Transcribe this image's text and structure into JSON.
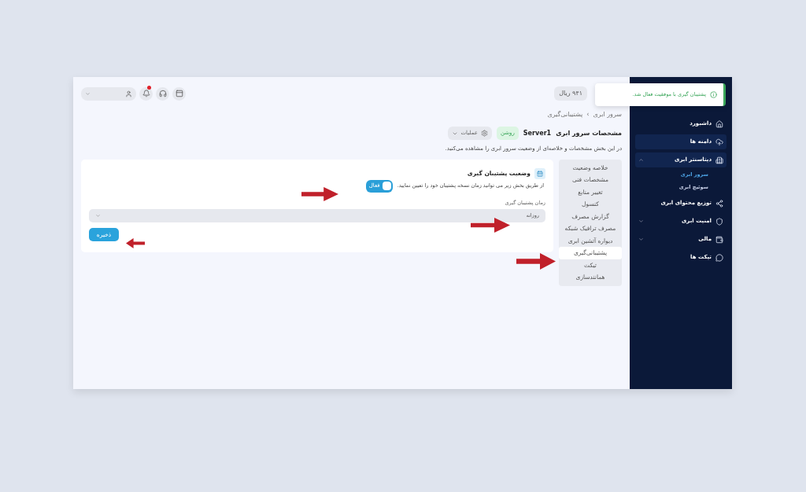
{
  "toast": {
    "message": "پشتیبان گیری با موفقیت فعال شد."
  },
  "topbar": {
    "balance": "۹۴۱ ریال",
    "notifications_unread": true
  },
  "breadcrumb": [
    "سرور ابری",
    "پشتیبانی‌گیری"
  ],
  "breadcrumb_separator": "›",
  "header": {
    "title": "مشخصات سرور ابری",
    "server": "Server1",
    "status": "روشن",
    "actions": "عملیات"
  },
  "description": "در این بخش مشخصات و خلاصه‌ای از وضعیت سرور ابری را مشاهده می‌کنید.",
  "backup": {
    "title": "وضعیت پشتیبان گیری",
    "hint": "از طریق بخش زیر می توانید زمان نسخه پشتیبان خود را تعیین نمایید.",
    "toggle": {
      "label": "فعال",
      "on": true
    },
    "schedule_label": "زمان پشتیبان گیری",
    "schedule_value": "روزانه",
    "save": "ذخیره"
  },
  "submenu": [
    {
      "label": "خلاصه وضعیت",
      "selected": false
    },
    {
      "label": "مشخصات فنی",
      "selected": false
    },
    {
      "label": "تغییر منابع",
      "selected": false
    },
    {
      "label": "کنسول",
      "selected": false
    },
    {
      "label": "گزارش مصرف",
      "selected": false
    },
    {
      "label": "مصرف ترافیک شبکه",
      "selected": false
    },
    {
      "label": "دیواره آتشین ابری",
      "selected": false
    },
    {
      "label": "پشتیبانی‌گیری",
      "selected": true
    },
    {
      "label": "تیکت",
      "selected": false
    },
    {
      "label": "همانندسازی",
      "selected": false
    }
  ],
  "sidebar": [
    {
      "label": "داشبورد",
      "highlighted": false
    },
    {
      "label": "دامنه ها",
      "highlighted": true
    },
    {
      "label": "دیتاسنتر ابری",
      "highlighted": true,
      "expanded": true,
      "children": [
        {
          "label": "سرور ابری",
          "selected": true
        },
        {
          "label": "سوئیچ ابری",
          "selected": false
        }
      ]
    },
    {
      "label": "توزیع محتوای ابری",
      "highlighted": false
    },
    {
      "label": "امنیت ابری",
      "highlighted": false,
      "expanded": false
    },
    {
      "label": "مالی",
      "highlighted": false,
      "expanded": false
    },
    {
      "label": "تیکت ها",
      "highlighted": false
    }
  ]
}
